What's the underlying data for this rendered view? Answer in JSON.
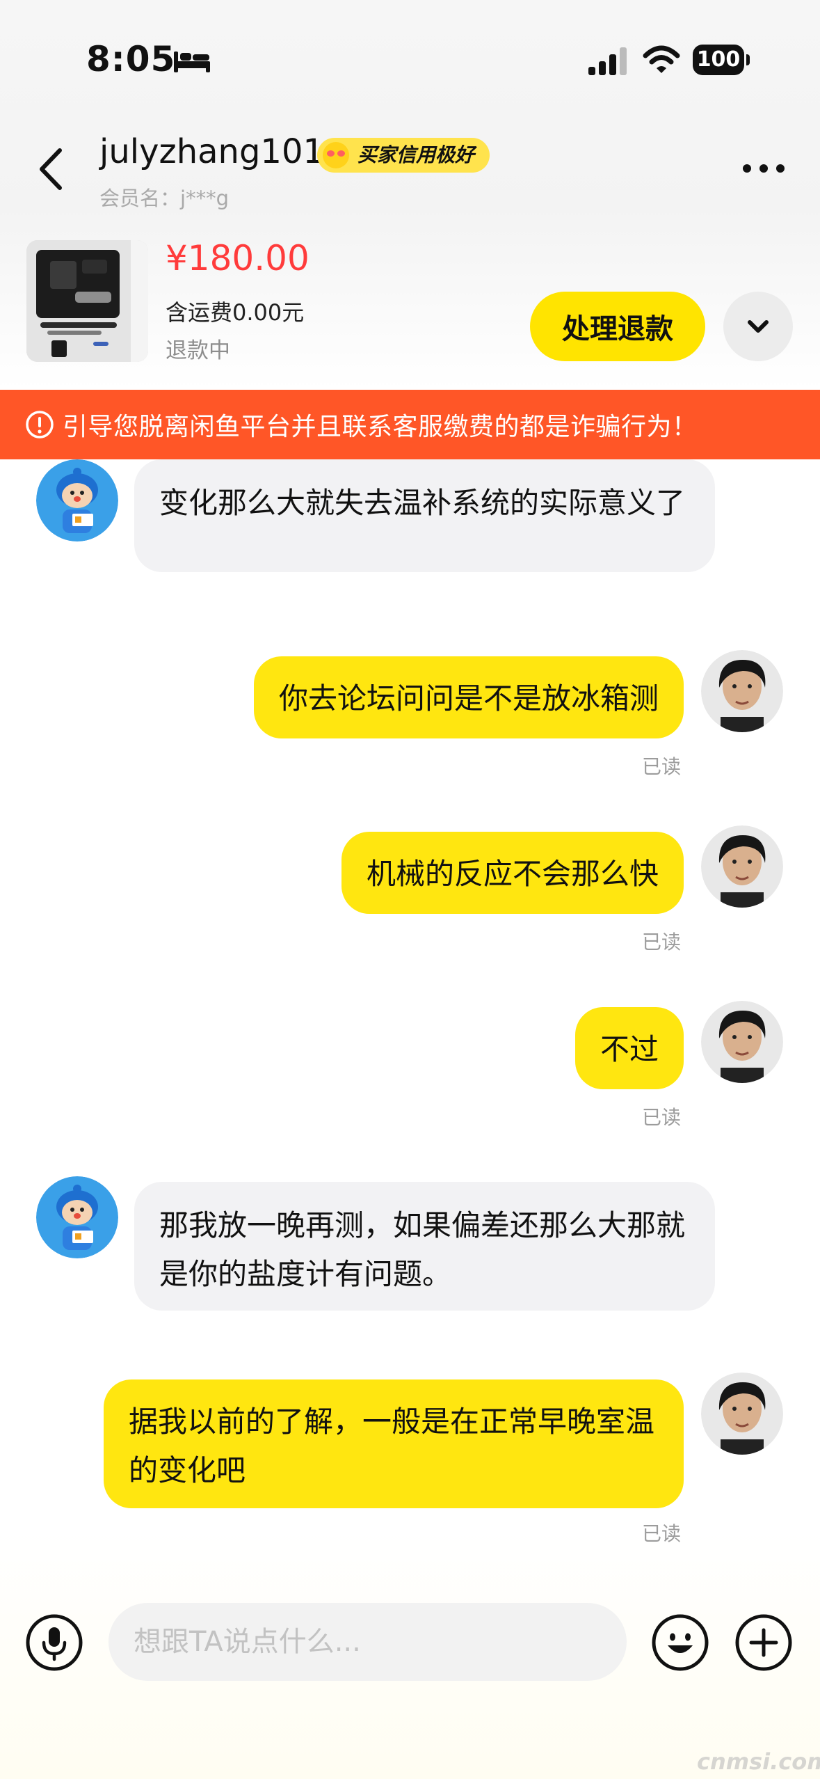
{
  "status_bar": {
    "time": "8:05",
    "battery": "100"
  },
  "header": {
    "username": "julyzhang101",
    "credit_badge": "买家信用极好",
    "member_label": "会员名：",
    "member_value": "j***g"
  },
  "product": {
    "price": "¥180.00",
    "shipping": "含运费0.00元",
    "status": "退款中",
    "action_label": "处理退款"
  },
  "warning": {
    "text": "引导您脱离闲鱼平台并且联系客服缴费的都是诈骗行为！"
  },
  "messages": [
    {
      "from": "buyer",
      "text": "变化那么大就失去温补系统的实际意义了"
    },
    {
      "from": "self",
      "text": "你去论坛问问是不是放冰箱测",
      "status": "已读"
    },
    {
      "from": "self",
      "text": "机械的反应不会那么快",
      "status": "已读"
    },
    {
      "from": "self",
      "text": "不过",
      "status": "已读"
    },
    {
      "from": "buyer",
      "text": "那我放一晚再测，如果偏差还那么大那就是你的盐度计有问题。"
    },
    {
      "from": "self",
      "text": "据我以前的了解，一般是在正常早晚室温的变化吧",
      "status": "已读"
    }
  ],
  "input": {
    "placeholder": "想跟TA说点什么..."
  },
  "watermark": "cnmsi.com",
  "colors": {
    "accent_yellow": "#ffe400",
    "warning_orange": "#ff5627",
    "price_red": "#ff3b3b",
    "incoming_bubble": "#f2f2f4",
    "outgoing_bubble": "#ffe610"
  },
  "icons": [
    "bed-icon",
    "signal-icon",
    "wifi-icon",
    "battery-icon",
    "back-arrow-icon",
    "more-icon",
    "chevron-down-icon",
    "warning-circle-icon",
    "microphone-icon",
    "emoji-icon",
    "plus-icon"
  ]
}
